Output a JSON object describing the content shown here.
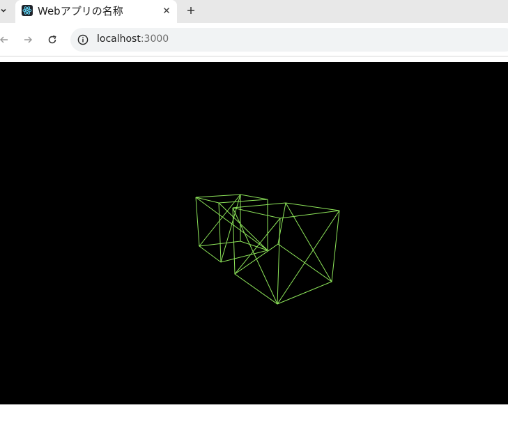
{
  "browser": {
    "tab": {
      "title": "Webアプリの名称",
      "favicon": "react-logo-icon",
      "close_icon": "close-icon"
    },
    "new_tab_icon": "plus-icon",
    "tab_list_icon": "chevron-down-icon",
    "nav": {
      "back_icon": "arrow-left-icon",
      "forward_icon": "arrow-right-icon",
      "reload_icon": "reload-icon"
    },
    "address": {
      "site_info_icon": "info-icon",
      "host": "localhost",
      "port": ":3000"
    }
  },
  "scene": {
    "background": "#000000",
    "wireframe_color": "#8ee65a",
    "objects": [
      "wireframe-cube",
      "wireframe-cube"
    ]
  }
}
